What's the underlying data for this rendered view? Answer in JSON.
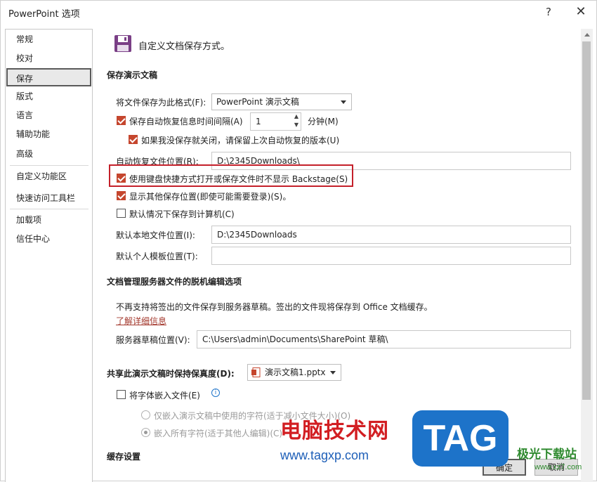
{
  "window": {
    "title": "PowerPoint 选项",
    "help_symbol": "?",
    "close_symbol": "✕"
  },
  "sidebar": {
    "items": [
      {
        "label": "常规"
      },
      {
        "label": "校对"
      },
      {
        "label": "保存",
        "active": true
      },
      {
        "label": "版式"
      },
      {
        "label": "语言"
      },
      {
        "label": "辅助功能"
      },
      {
        "label": "高级"
      },
      {
        "label": "自定义功能区"
      },
      {
        "label": "快速访问工具栏"
      },
      {
        "label": "加载项"
      },
      {
        "label": "信任中心"
      }
    ]
  },
  "main": {
    "header": "自定义文档保存方式。",
    "save_section": {
      "title": "保存演示文稿",
      "format_label": "将文件保存为此格式(F):",
      "format_value": "PowerPoint 演示文稿",
      "autorecover_label": "保存自动恢复信息时间间隔(A)",
      "autorecover_checked": true,
      "autorecover_value": "1",
      "minutes_label": "分钟(M)",
      "keep_last_label": "如果我没保存就关闭，请保留上次自动恢复的版本(U)",
      "keep_last_checked": true,
      "autorecover_location_label": "自动恢复文件位置(R):",
      "autorecover_location_value": "D:\\2345Downloads\\",
      "no_backstage_label": "使用键盘快捷方式打开或保存文件时不显示 Backstage(S)",
      "no_backstage_checked": true,
      "show_more_label": "显示其他保存位置(即使可能需要登录)(S)。",
      "show_more_checked": true,
      "default_computer_label": "默认情况下保存到计算机(C)",
      "default_computer_checked": false,
      "default_local_label": "默认本地文件位置(I):",
      "default_local_value": "D:\\2345Downloads",
      "default_template_label": "默认个人模板位置(T):",
      "default_template_value": ""
    },
    "offline_section": {
      "title": "文档管理服务器文件的脱机编辑选项",
      "description": "不再支持将签出的文件保存到服务器草稿。签出的文件现将保存到 Office 文档缓存。",
      "learn_more": "了解详细信息",
      "server_drafts_label": "服务器草稿位置(V):",
      "server_drafts_value": "C:\\Users\\admin\\Documents\\SharePoint 草稿\\"
    },
    "fidelity_section": {
      "title": "共享此演示文稿时保持保真度(D):",
      "file_value": "演示文稿1.pptx",
      "embed_fonts_label": "将字体嵌入文件(E)",
      "embed_fonts_checked": false,
      "info_symbol": "i",
      "embed_used_label": "仅嵌入演示文稿中使用的字符(适于减小文件大小)(O)",
      "embed_all_label": "嵌入所有字符(适于其他人编辑)(C)"
    },
    "cache_section": {
      "title": "缓存设置"
    }
  },
  "footer": {
    "ok_label": "确定",
    "cancel_label": "取消"
  },
  "watermark": {
    "text": "电脑技术网",
    "url": "www.tagxp.com",
    "badge": "TAG",
    "site": "极光下载站",
    "site_url": "www.xz7.com"
  },
  "colors": {
    "checkbox_accent": "#c5462e",
    "highlight_border": "#c4202a",
    "link": "#a3382d",
    "save_icon": "#7a3f86"
  }
}
